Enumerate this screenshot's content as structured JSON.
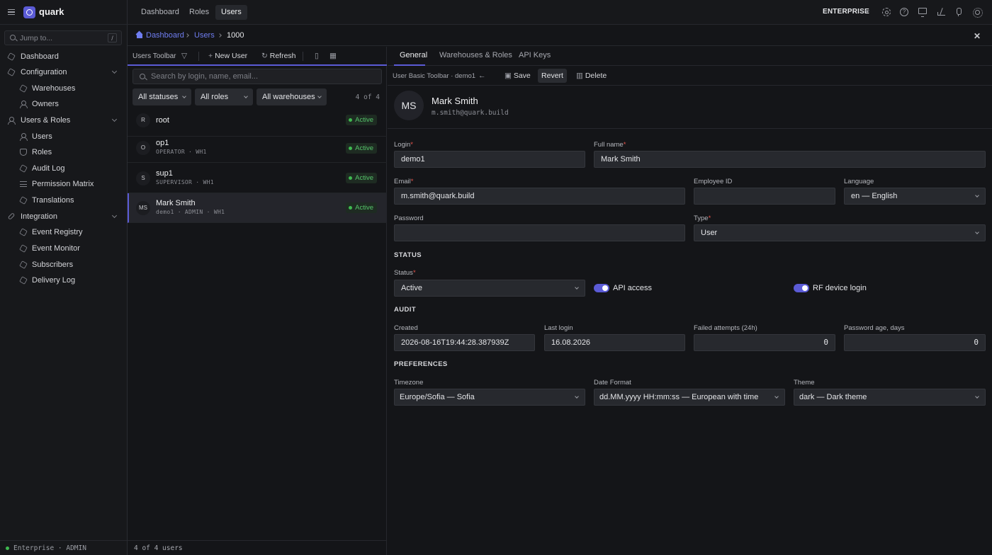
{
  "app": {
    "name": "quark"
  },
  "sidebar": {
    "search_placeholder": "Jump to...",
    "search_kbd": "/",
    "items": [
      {
        "label": "Dashboard"
      },
      {
        "label": "Configuration"
      },
      {
        "label": "Warehouses"
      },
      {
        "label": "Owners"
      },
      {
        "label": "Users & Roles"
      },
      {
        "label": "Users"
      },
      {
        "label": "Roles"
      },
      {
        "label": "Audit Log"
      },
      {
        "label": "Permission Matrix"
      },
      {
        "label": "Translations"
      },
      {
        "label": "Integration"
      },
      {
        "label": "Event Registry"
      },
      {
        "label": "Event Monitor"
      },
      {
        "label": "Subscribers"
      },
      {
        "label": "Delivery Log"
      }
    ],
    "footer": "Enterprise · ADMIN"
  },
  "topbar": {
    "tabs": [
      {
        "label": "Dashboard"
      },
      {
        "label": "Roles"
      },
      {
        "label": "Users"
      }
    ],
    "edition": "ENTERPRISE"
  },
  "breadcrumb": {
    "items": [
      {
        "label": "Dashboard"
      },
      {
        "label": "Users"
      },
      {
        "label": "1000"
      }
    ]
  },
  "list": {
    "toolbar_title": "Users Toolbar",
    "new_user": "New User",
    "refresh": "Refresh",
    "search_placeholder": "Search by login, name, email...",
    "filters": {
      "status": "All statuses",
      "role": "All roles",
      "warehouse": "All warehouses"
    },
    "count": "4 of 4",
    "rows": [
      {
        "initials": "R",
        "name": "root",
        "meta": "",
        "status": "Active"
      },
      {
        "initials": "O",
        "name": "op1",
        "meta": "OPERATOR · WH1",
        "status": "Active"
      },
      {
        "initials": "S",
        "name": "sup1",
        "meta": "SUPERVISOR · WH1",
        "status": "Active"
      },
      {
        "initials": "MS",
        "name": "Mark Smith",
        "meta": "demo1 · ADMIN · WH1",
        "status": "Active"
      }
    ],
    "footer": "4 of 4 users"
  },
  "detail": {
    "tabs": [
      {
        "label": "General"
      },
      {
        "label": "Warehouses & Roles"
      },
      {
        "label": "API Keys"
      }
    ],
    "toolbar_title": "User Basic Toolbar · demo1",
    "save": "Save",
    "revert": "Revert",
    "delete": "Delete",
    "header": {
      "initials": "MS",
      "name": "Mark Smith",
      "email": "m.smith@quark.build"
    },
    "fields": {
      "login": {
        "label": "Login",
        "value": "demo1"
      },
      "full_name": {
        "label": "Full name",
        "value": "Mark Smith"
      },
      "email": {
        "label": "Email",
        "value": "m.smith@quark.build"
      },
      "employee_id": {
        "label": "Employee ID",
        "value": ""
      },
      "language": {
        "label": "Language",
        "value": "en — English"
      },
      "password": {
        "label": "Password",
        "value": ""
      },
      "type": {
        "label": "Type",
        "value": "User"
      }
    },
    "status_section": {
      "title": "STATUS",
      "status_label": "Status",
      "status_value": "Active",
      "api_access": "API access",
      "rf_login": "RF device login"
    },
    "audit_section": {
      "title": "AUDIT",
      "created_label": "Created",
      "created_value": "2026-08-16T19:44:28.387939Z",
      "last_login_label": "Last login",
      "last_login_value": "16.08.2026",
      "failed_label": "Failed attempts (24h)",
      "failed_value": "0",
      "pwd_age_label": "Password age, days",
      "pwd_age_value": "0"
    },
    "prefs_section": {
      "title": "PREFERENCES",
      "timezone_label": "Timezone",
      "timezone_value": "Europe/Sofia — Sofia",
      "date_label": "Date Format",
      "date_value": "dd.MM.yyyy HH:mm:ss — European with time",
      "theme_label": "Theme",
      "theme_value": "dark — Dark theme"
    }
  },
  "colors": {
    "accent": "#5b5bd6",
    "active": "#3fb950",
    "required": "#e5534b",
    "link": "#6f7df0"
  }
}
